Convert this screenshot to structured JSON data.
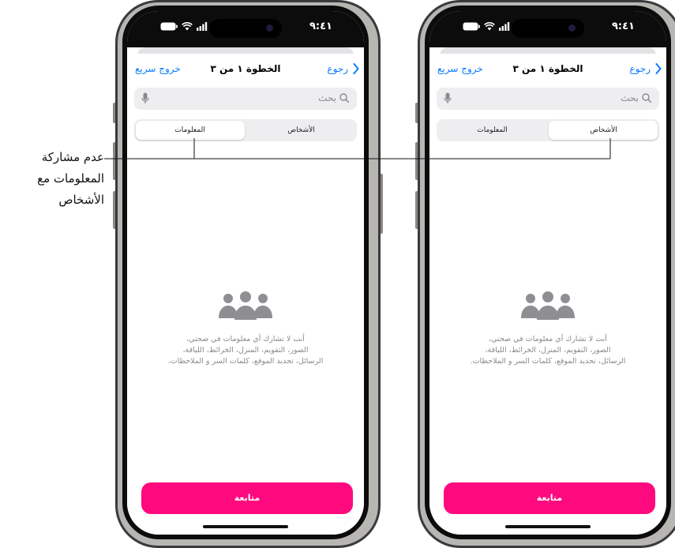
{
  "callout": {
    "lines": [
      "عدم مشاركة",
      "المعلومات مع",
      "الأشخاص"
    ]
  },
  "phones": [
    {
      "status_time": "٩:٤١",
      "nav": {
        "back_label": "رجوع",
        "title": "الخطوة ١ من ٣",
        "quick_exit_label": "خروج سريع"
      },
      "search_placeholder": "بحث",
      "segments": {
        "people": "الأشخاص",
        "information": "المعلومات",
        "selected": "information"
      },
      "empty_lines": [
        "أنت لا تشارك أي معلومات في صحتي،",
        "الصور، التقويم، المنزل، الخرائط، اللياقة،",
        "الرسائل، تحديد الموقع، كلمات السر و الملاحظات."
      ],
      "continue_label": "متابعة"
    },
    {
      "status_time": "٩:٤١",
      "nav": {
        "back_label": "رجوع",
        "title": "الخطوة ١ من ٣",
        "quick_exit_label": "خروج سريع"
      },
      "search_placeholder": "بحث",
      "segments": {
        "people": "الأشخاص",
        "information": "المعلومات",
        "selected": "people"
      },
      "empty_lines": [
        "أنت لا تشارك أي معلومات في صحتي،",
        "الصور، التقويم، المنزل، الخرائط، اللياقة،",
        "الرسائل، تحديد الموقع، كلمات السر و الملاحظات."
      ],
      "continue_label": "متابعة"
    }
  ],
  "colors": {
    "accent_blue": "#0a7aff",
    "continue_pink": "#ff0a7e",
    "secondary_text": "#8a8a8e"
  },
  "icons": {
    "back": "chevron-left-icon",
    "search": "magnifier-icon",
    "mic": "microphone-icon",
    "people": "three-people-icon",
    "wifi": "wifi-icon",
    "battery": "battery-icon",
    "signal": "signal-bars-icon"
  }
}
